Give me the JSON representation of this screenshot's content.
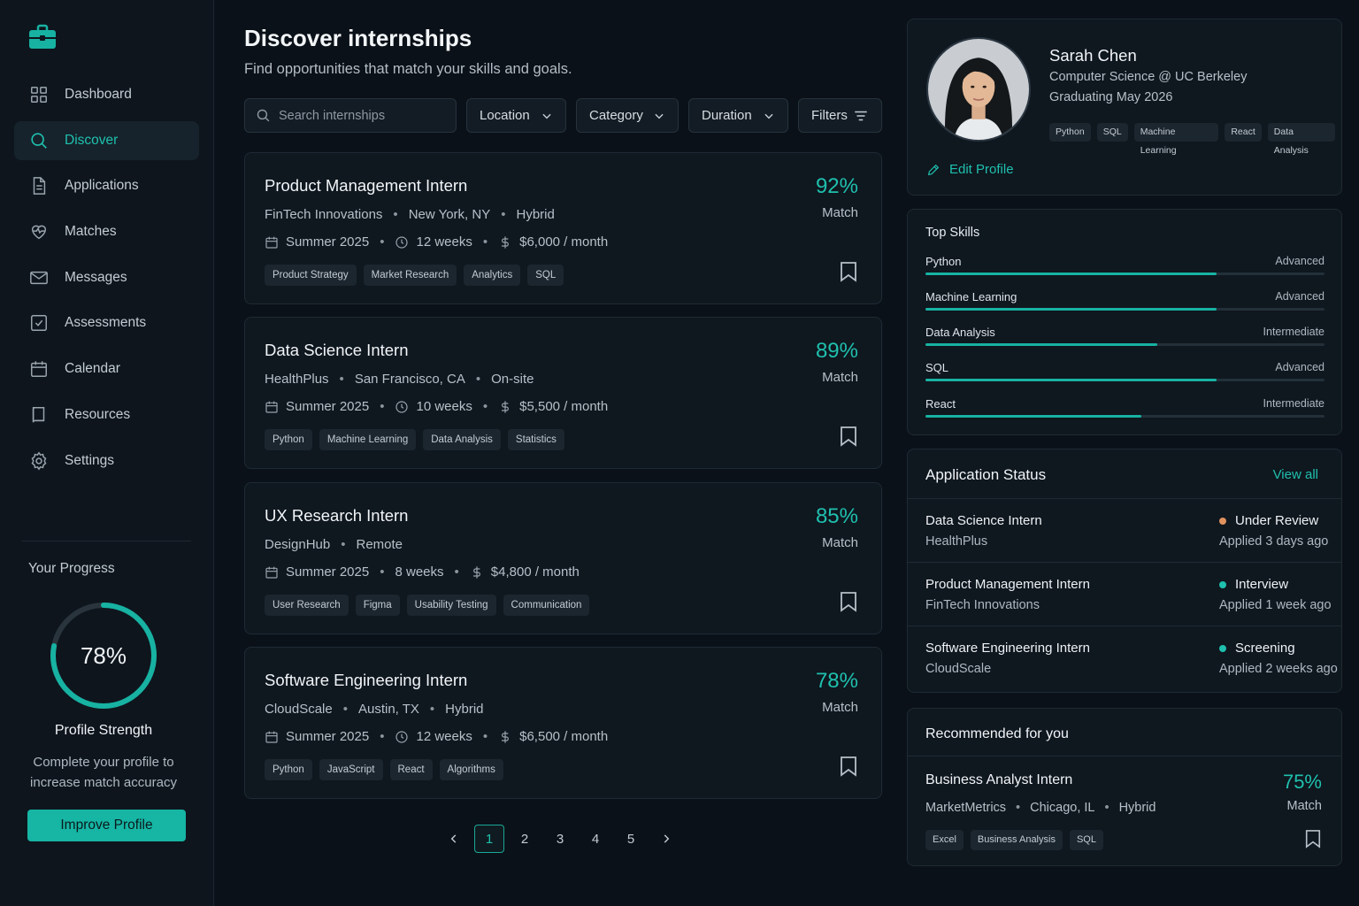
{
  "sidebar": {
    "logo_icon": "briefcase-icon",
    "nav": [
      {
        "label": "Dashboard",
        "icon": "grid-icon"
      },
      {
        "label": "Discover",
        "icon": "search-icon",
        "active": true
      },
      {
        "label": "Applications",
        "icon": "document-icon"
      },
      {
        "label": "Matches",
        "icon": "heart-pulse-icon"
      },
      {
        "label": "Messages",
        "icon": "mail-icon"
      },
      {
        "label": "Assessments",
        "icon": "checkbox-icon"
      },
      {
        "label": "Calendar",
        "icon": "calendar-icon"
      },
      {
        "label": "Resources",
        "icon": "book-icon"
      },
      {
        "label": "Settings",
        "icon": "gear-icon"
      }
    ],
    "progress": {
      "title": "Your Progress",
      "percent_label": "78%",
      "percent_value": 78,
      "label": "Profile Strength",
      "description": "Complete your profile to increase match accuracy",
      "button": "Improve Profile"
    }
  },
  "main": {
    "title": "Discover internships",
    "subtitle": "Find opportunities that match your skills and goals.",
    "search_placeholder": "Search internships",
    "filters": {
      "location": "Location",
      "category": "Category",
      "duration": "Duration",
      "more": "Filters"
    },
    "jobs": [
      {
        "title": "Product Management Intern",
        "company": "FinTech Innovations",
        "location": "New York, NY",
        "mode": "Hybrid",
        "term": "Summer 2025",
        "duration": "12 weeks",
        "pay": "$6,000 / month",
        "tags": [
          "Product Strategy",
          "Market Research",
          "Analytics",
          "SQL"
        ],
        "match": "92%",
        "match_label": "Match"
      },
      {
        "title": "Data Science Intern",
        "company": "HealthPlus",
        "location": "San Francisco, CA",
        "mode": "On-site",
        "term": "Summer 2025",
        "duration": "10 weeks",
        "pay": "$5,500 / month",
        "tags": [
          "Python",
          "Machine Learning",
          "Data Analysis",
          "Statistics"
        ],
        "match": "89%",
        "match_label": "Match"
      },
      {
        "title": "UX Research Intern",
        "company": "DesignHub",
        "location": "Remote",
        "term": "Summer 2025",
        "duration": "8 weeks",
        "pay": "$4,800 / month",
        "tags": [
          "User Research",
          "Figma",
          "Usability Testing",
          "Communication"
        ],
        "match": "85%",
        "match_label": "Match"
      },
      {
        "title": "Software Engineering Intern",
        "company": "CloudScale",
        "location": "Austin, TX",
        "mode": "Hybrid",
        "term": "Summer 2025",
        "duration": "12 weeks",
        "pay": "$6,500 / month",
        "tags": [
          "Python",
          "JavaScript",
          "React",
          "Algorithms"
        ],
        "match": "78%",
        "match_label": "Match"
      }
    ],
    "pagination": {
      "pages": [
        "1",
        "2",
        "3",
        "4",
        "5"
      ],
      "current": "1"
    }
  },
  "profile": {
    "name": "Sarah Chen",
    "program": "Computer Science @ UC Berkeley",
    "graduation": "Graduating May 2026",
    "tags": [
      "Python",
      "SQL",
      "Machine Learning",
      "React",
      "Data Analysis"
    ],
    "edit_label": "Edit Profile"
  },
  "skills": {
    "title": "Top Skills",
    "items": [
      {
        "name": "Python",
        "level": "Advanced",
        "value": 0.73
      },
      {
        "name": "Machine Learning",
        "level": "Advanced",
        "value": 0.73
      },
      {
        "name": "Data Analysis",
        "level": "Intermediate",
        "value": 0.58
      },
      {
        "name": "SQL",
        "level": "Advanced",
        "value": 0.73
      },
      {
        "name": "React",
        "level": "Intermediate",
        "value": 0.54
      }
    ]
  },
  "status": {
    "title": "Application Status",
    "view_all": "View all",
    "items": [
      {
        "job": "Data Science Intern",
        "company": "HealthPlus",
        "state": "Under Review",
        "applied": "Applied 3 days ago",
        "color": "#e0925e"
      },
      {
        "job": "Product Management Intern",
        "company": "FinTech Innovations",
        "state": "Interview",
        "applied": "Applied 1 week ago",
        "color": "#1fc0ae"
      },
      {
        "job": "Software Engineering Intern",
        "company": "CloudScale",
        "state": "Screening",
        "applied": "Applied 2 weeks ago",
        "color": "#1fc0ae"
      }
    ]
  },
  "recommended": {
    "title": "Recommended for you",
    "job": "Business Analyst Intern",
    "company": "MarketMetrics",
    "location": "Chicago, IL",
    "mode": "Hybrid",
    "tags": [
      "Excel",
      "Business Analysis",
      "SQL"
    ],
    "match": "75%",
    "match_label": "Match"
  },
  "colors": {
    "accent": "#1fc0ae",
    "background": "#0b1118",
    "panel": "#0f171f"
  }
}
